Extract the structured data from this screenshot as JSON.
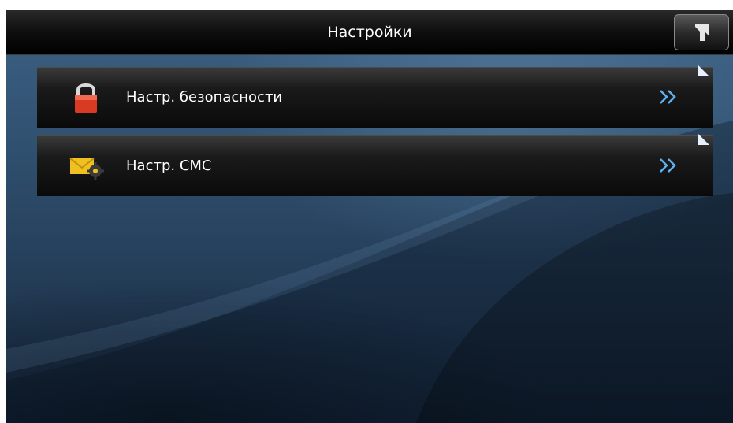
{
  "header": {
    "title": "Настройки",
    "back_icon": "back-arrow-icon"
  },
  "menu": {
    "items": [
      {
        "label": "Настр. безопасности",
        "icon": "lock-icon",
        "chevron": "double-chevron-right-icon"
      },
      {
        "label": "Настр. СМС",
        "icon": "sms-settings-icon",
        "chevron": "double-chevron-right-icon"
      }
    ]
  },
  "colors": {
    "title_bar": "#000000",
    "row_background": "#1a1a1a",
    "text": "#ffffff",
    "chevron": "#5fb0f0",
    "lock": "#d83a24",
    "envelope": "#f0c020"
  }
}
